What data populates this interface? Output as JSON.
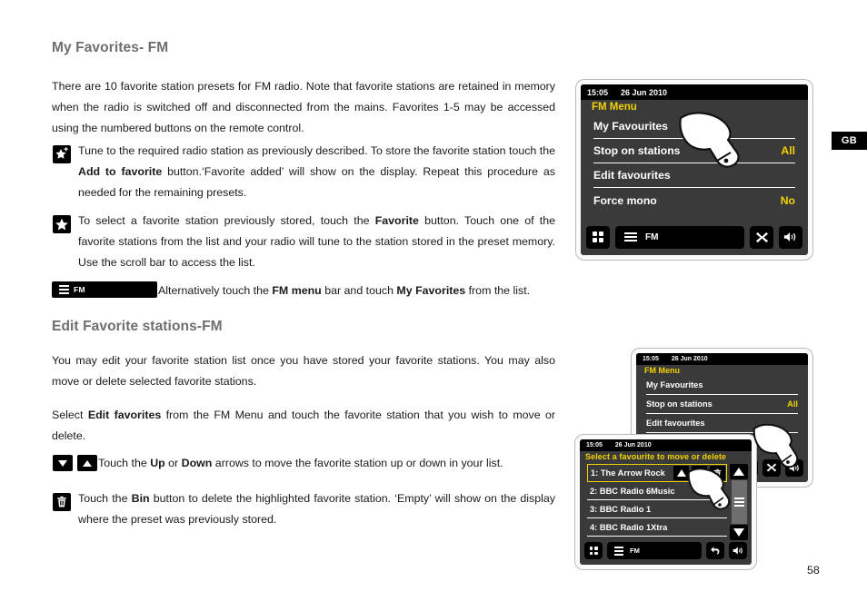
{
  "page": {
    "number": "58",
    "region_tab": "GB"
  },
  "sections": [
    {
      "id": "my-favorites-fm",
      "title": "My Favorites- FM"
    },
    {
      "id": "edit-favorite-stations-fm",
      "title": "Edit Favorite stations-FM"
    }
  ],
  "body": {
    "intro_paragraph": "There are 10 favorite station presets for FM radio. Note that favorite stations are retained in memory when the radio is switched off and disconnected from the mains. Favorites 1-5 may be accessed using the numbered buttons on the remote control.",
    "bullet_add_favorite": {
      "icon": "star-plus-icon",
      "text_part_1": "Tune to the required radio station as previously described. To store the favorite station touch the ",
      "bold_1": "Add to favorite",
      "text_part_2": " button.‘Favorite added’ will show on the display. Repeat this procedure as needed for the remaining presets."
    },
    "bullet_select_favorite": {
      "icon": "star-icon",
      "text_part_1": "To select a favorite station previously stored, touch the ",
      "bold_1": "Favorite",
      "text_part_2": " button. Touch one of the favorite stations from the list and your radio will tune to the station stored in the preset memory. Use the scroll bar to access the list."
    },
    "fm_menu_alt_line": {
      "button_label": "FM",
      "button_icon": "hamburger-menu-icon",
      "text_part_1": "Alternatively touch the ",
      "bold_1": "FM menu",
      "text_part_2": " bar and touch ",
      "bold_2": "My Favorites",
      "text_part_3": " from the list."
    },
    "edit_paragraph_1": "You may edit your favorite station list once you have stored your favorite stations. You may also move or delete selected favorite stations.",
    "edit_paragraph_2": {
      "text_part_1": "Select ",
      "bold_1": "Edit favorites",
      "text_part_2": " from the FM Menu and touch the favorite station that you wish to move or delete."
    },
    "bullet_up_down": {
      "icon_down": "arrow-down-icon",
      "icon_up": "arrow-up-icon",
      "text_part_1": "Touch the ",
      "bold_1": "Up",
      "text_part_2": " or ",
      "bold_2": "Down",
      "text_part_3": " arrows to move the favorite station up or down in your list."
    },
    "bullet_bin": {
      "icon": "bin-icon",
      "text_part_1": "Touch the ",
      "bold_1": "Bin",
      "text_part_2": " button to delete the highlighted favorite station. ‘Empty’ will show on the display where the preset was previously stored."
    }
  },
  "device_top": {
    "status": {
      "time": "15:05",
      "date": "26 Jun 2010"
    },
    "screen_title": "FM Menu",
    "menu_rows": [
      {
        "label": "My Favourites",
        "value": ""
      },
      {
        "label": "Stop on stations",
        "value": "All"
      },
      {
        "label": "Edit favourites",
        "value": ""
      },
      {
        "label": "Force mono",
        "value": "No"
      }
    ],
    "buttons": {
      "home": "grid-icon",
      "source_label": "FM",
      "source_icon": "hamburger-menu-icon",
      "close": "close-x-icon",
      "volume": "speaker-icon"
    },
    "pointer": "hand-pointer-icon"
  },
  "device_back": {
    "status": {
      "time": "15:05",
      "date": "26 Jun 2010"
    },
    "screen_title": "FM Menu",
    "menu_rows": [
      {
        "label": "My Favourites",
        "value": ""
      },
      {
        "label": "Stop on stations",
        "value": "All"
      },
      {
        "label": "Edit favourites",
        "value": ""
      }
    ],
    "buttons": {
      "home": "grid-icon",
      "source_label": "FM",
      "close": "close-x-icon",
      "volume": "speaker-icon"
    },
    "pointer": "hand-pointer-icon"
  },
  "device_front": {
    "status": {
      "time": "15:05",
      "date": "26 Jun 2010"
    },
    "screen_title": "Select a favourite to move or delete",
    "list_rows": [
      {
        "label": "1: The Arrow Rock",
        "selected": true
      },
      {
        "label": "2: BBC Radio 6Music",
        "selected": false
      },
      {
        "label": "3: BBC Radio 1",
        "selected": false
      },
      {
        "label": "4: BBC Radio 1Xtra",
        "selected": false
      }
    ],
    "row_controls": {
      "up": "arrow-up-icon",
      "down": "arrow-down-icon",
      "bin": "bin-icon"
    },
    "scrollbar": {
      "up": "scroll-up-icon",
      "grip": "scroll-grip-icon",
      "down": "scroll-down-icon"
    },
    "buttons": {
      "home": "grid-icon",
      "source_label": "FM",
      "back": "back-arrow-icon",
      "volume": "speaker-icon"
    },
    "pointer": "hand-pointer-icon"
  },
  "colors": {
    "accent_yellow": "#f2d202",
    "screen_bg": "#3a3a3a",
    "status_bg": "#000000",
    "heading_gray": "#6e6e6e"
  }
}
